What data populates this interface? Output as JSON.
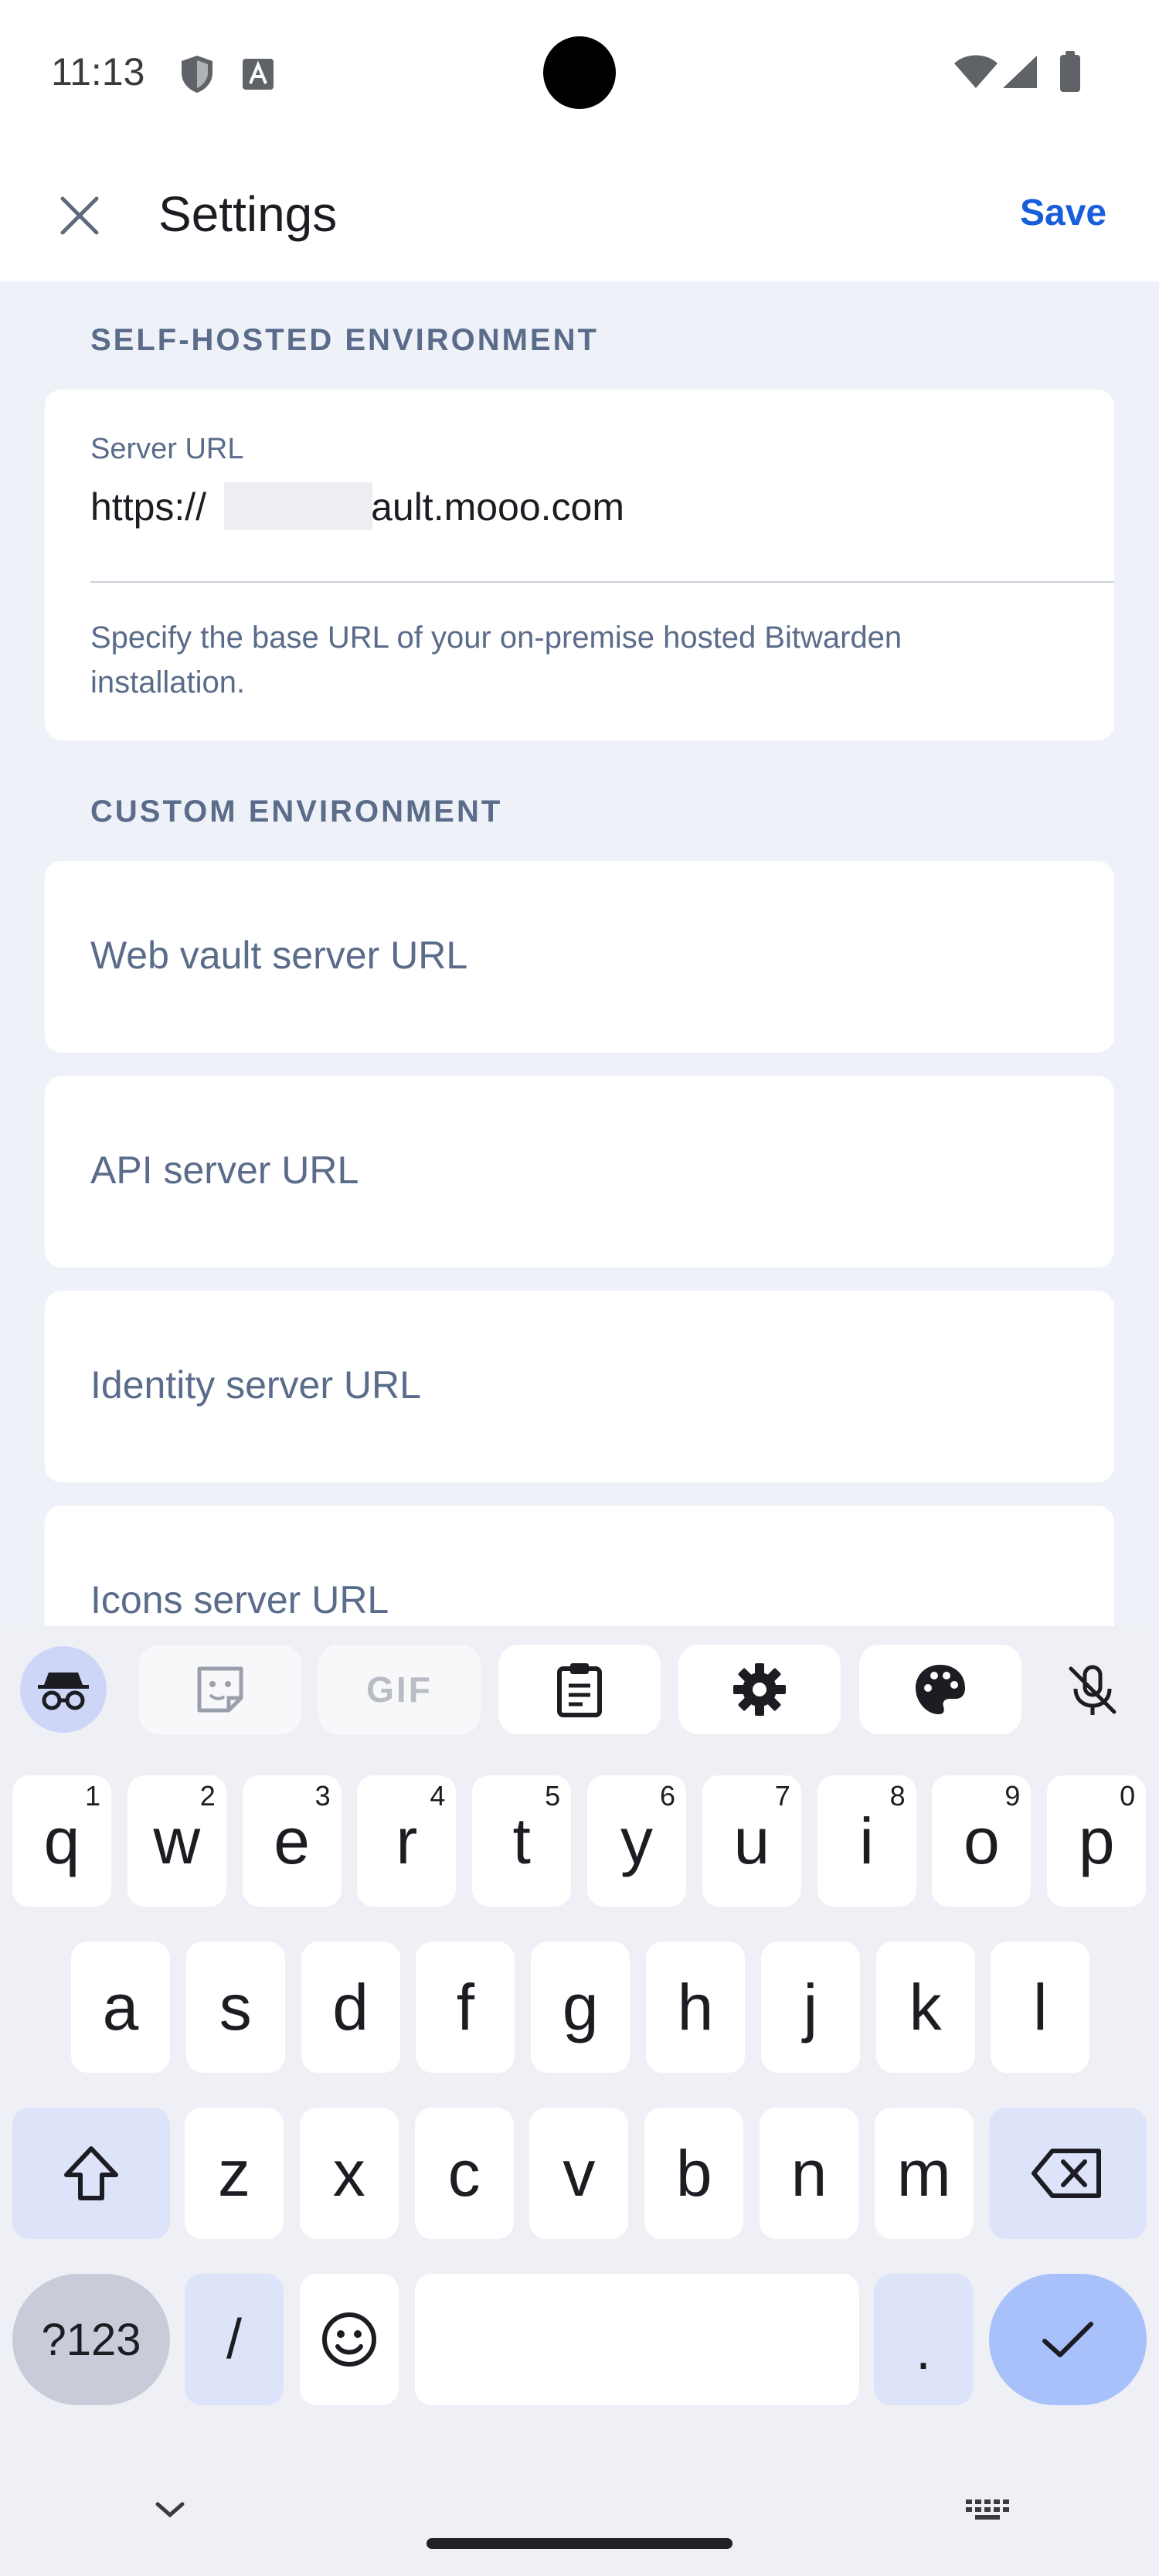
{
  "status_bar": {
    "time": "11:13"
  },
  "header": {
    "title": "Settings",
    "save_label": "Save"
  },
  "self_hosted": {
    "section_label": "SELF-HOSTED ENVIRONMENT",
    "server_url_label": "Server URL",
    "server_url_prefix": "https://",
    "server_url_suffix": "vault.mooo.com",
    "help_text": "Specify the base URL of your on-premise hosted Bitwarden installation."
  },
  "custom": {
    "section_label": "CUSTOM ENVIRONMENT",
    "fields": [
      {
        "placeholder": "Web vault server URL"
      },
      {
        "placeholder": "API server URL"
      },
      {
        "placeholder": "Identity server URL"
      },
      {
        "placeholder": "Icons server URL"
      }
    ]
  },
  "keyboard": {
    "toolbar": [
      "incognito-icon",
      "sticker-icon",
      "gif-icon",
      "clipboard-icon",
      "gear-icon",
      "palette-icon",
      "mic-off-icon"
    ],
    "gif_label": "GIF",
    "row1": [
      {
        "key": "q",
        "hint": "1"
      },
      {
        "key": "w",
        "hint": "2"
      },
      {
        "key": "e",
        "hint": "3"
      },
      {
        "key": "r",
        "hint": "4"
      },
      {
        "key": "t",
        "hint": "5"
      },
      {
        "key": "y",
        "hint": "6"
      },
      {
        "key": "u",
        "hint": "7"
      },
      {
        "key": "i",
        "hint": "8"
      },
      {
        "key": "o",
        "hint": "9"
      },
      {
        "key": "p",
        "hint": "0"
      }
    ],
    "row2": [
      "a",
      "s",
      "d",
      "f",
      "g",
      "h",
      "j",
      "k",
      "l"
    ],
    "row3": [
      "z",
      "x",
      "c",
      "v",
      "b",
      "n",
      "m"
    ],
    "symbols_label": "?123",
    "slash_label": "/",
    "period_label": "."
  },
  "colors": {
    "accent": "#175ddc",
    "background": "#eef2f8",
    "label": "#5a6c8a",
    "key_special": "#dde3f8",
    "enter": "#a8c1fb"
  }
}
